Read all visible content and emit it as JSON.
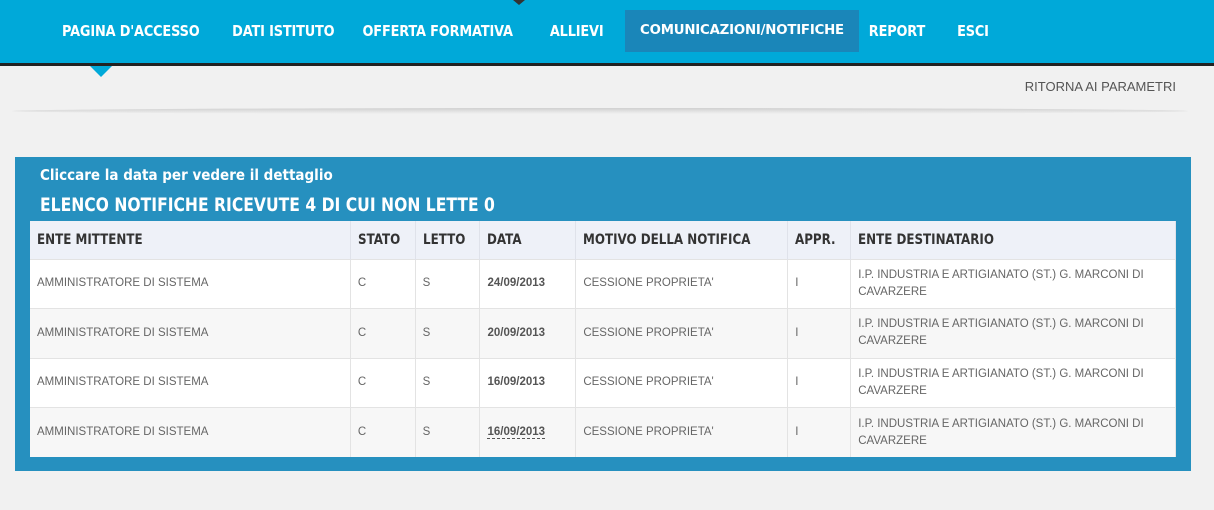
{
  "nav": {
    "items": [
      {
        "label": "PAGINA D'ACCESSO",
        "active": false
      },
      {
        "label": "DATI ISTITUTO",
        "active": false
      },
      {
        "label": "OFFERTA FORMATIVA",
        "active": false
      },
      {
        "label": "ALLIEVI",
        "active": false
      },
      {
        "label": "COMUNICAZIONI/NOTIFICHE",
        "active": true
      },
      {
        "label": "REPORT",
        "active": false
      },
      {
        "label": "ESCI",
        "active": false
      }
    ]
  },
  "subbar": {
    "ritorna_label": "RITORNA AI PARAMETRI"
  },
  "panel": {
    "hint": "Cliccare la data per vedere il dettaglio",
    "title": "ELENCO NOTIFICHE RICEVUTE 4 DI CUI NON LETTE 0"
  },
  "table": {
    "headers": [
      "ENTE MITTENTE",
      "STATO",
      "LETTO",
      "DATA",
      "MOTIVO DELLA NOTIFICA",
      "APPR.",
      "ENTE DESTINATARIO"
    ],
    "rows": [
      {
        "mittente": "AMMINISTRATORE DI SISTEMA",
        "stato": "C",
        "letto": "S",
        "data": "24/09/2013",
        "motivo": "CESSIONE PROPRIETA'",
        "appr": "I",
        "destinatario": "I.P. INDUSTRIA E ARTIGIANATO (ST.) G. MARCONI DI CAVARZERE"
      },
      {
        "mittente": "AMMINISTRATORE DI SISTEMA",
        "stato": "C",
        "letto": "S",
        "data": "20/09/2013",
        "motivo": "CESSIONE PROPRIETA'",
        "appr": "I",
        "destinatario": "I.P. INDUSTRIA E ARTIGIANATO (ST.) G. MARCONI DI CAVARZERE"
      },
      {
        "mittente": "AMMINISTRATORE DI SISTEMA",
        "stato": "C",
        "letto": "S",
        "data": "16/09/2013",
        "motivo": "CESSIONE PROPRIETA'",
        "appr": "I",
        "destinatario": "I.P. INDUSTRIA E ARTIGIANATO (ST.) G. MARCONI DI CAVARZERE"
      },
      {
        "mittente": "AMMINISTRATORE DI SISTEMA",
        "stato": "C",
        "letto": "S",
        "data": "16/09/2013",
        "motivo": "CESSIONE PROPRIETA'",
        "appr": "I",
        "destinatario": "I.P. INDUSTRIA E ARTIGIANATO (ST.) G. MARCONI DI CAVARZERE"
      }
    ]
  },
  "colors": {
    "nav_bg": "#00a9d9",
    "nav_active": "#1a86b9",
    "panel_bg": "#2690bf",
    "page_bg": "#f1f1f1"
  }
}
